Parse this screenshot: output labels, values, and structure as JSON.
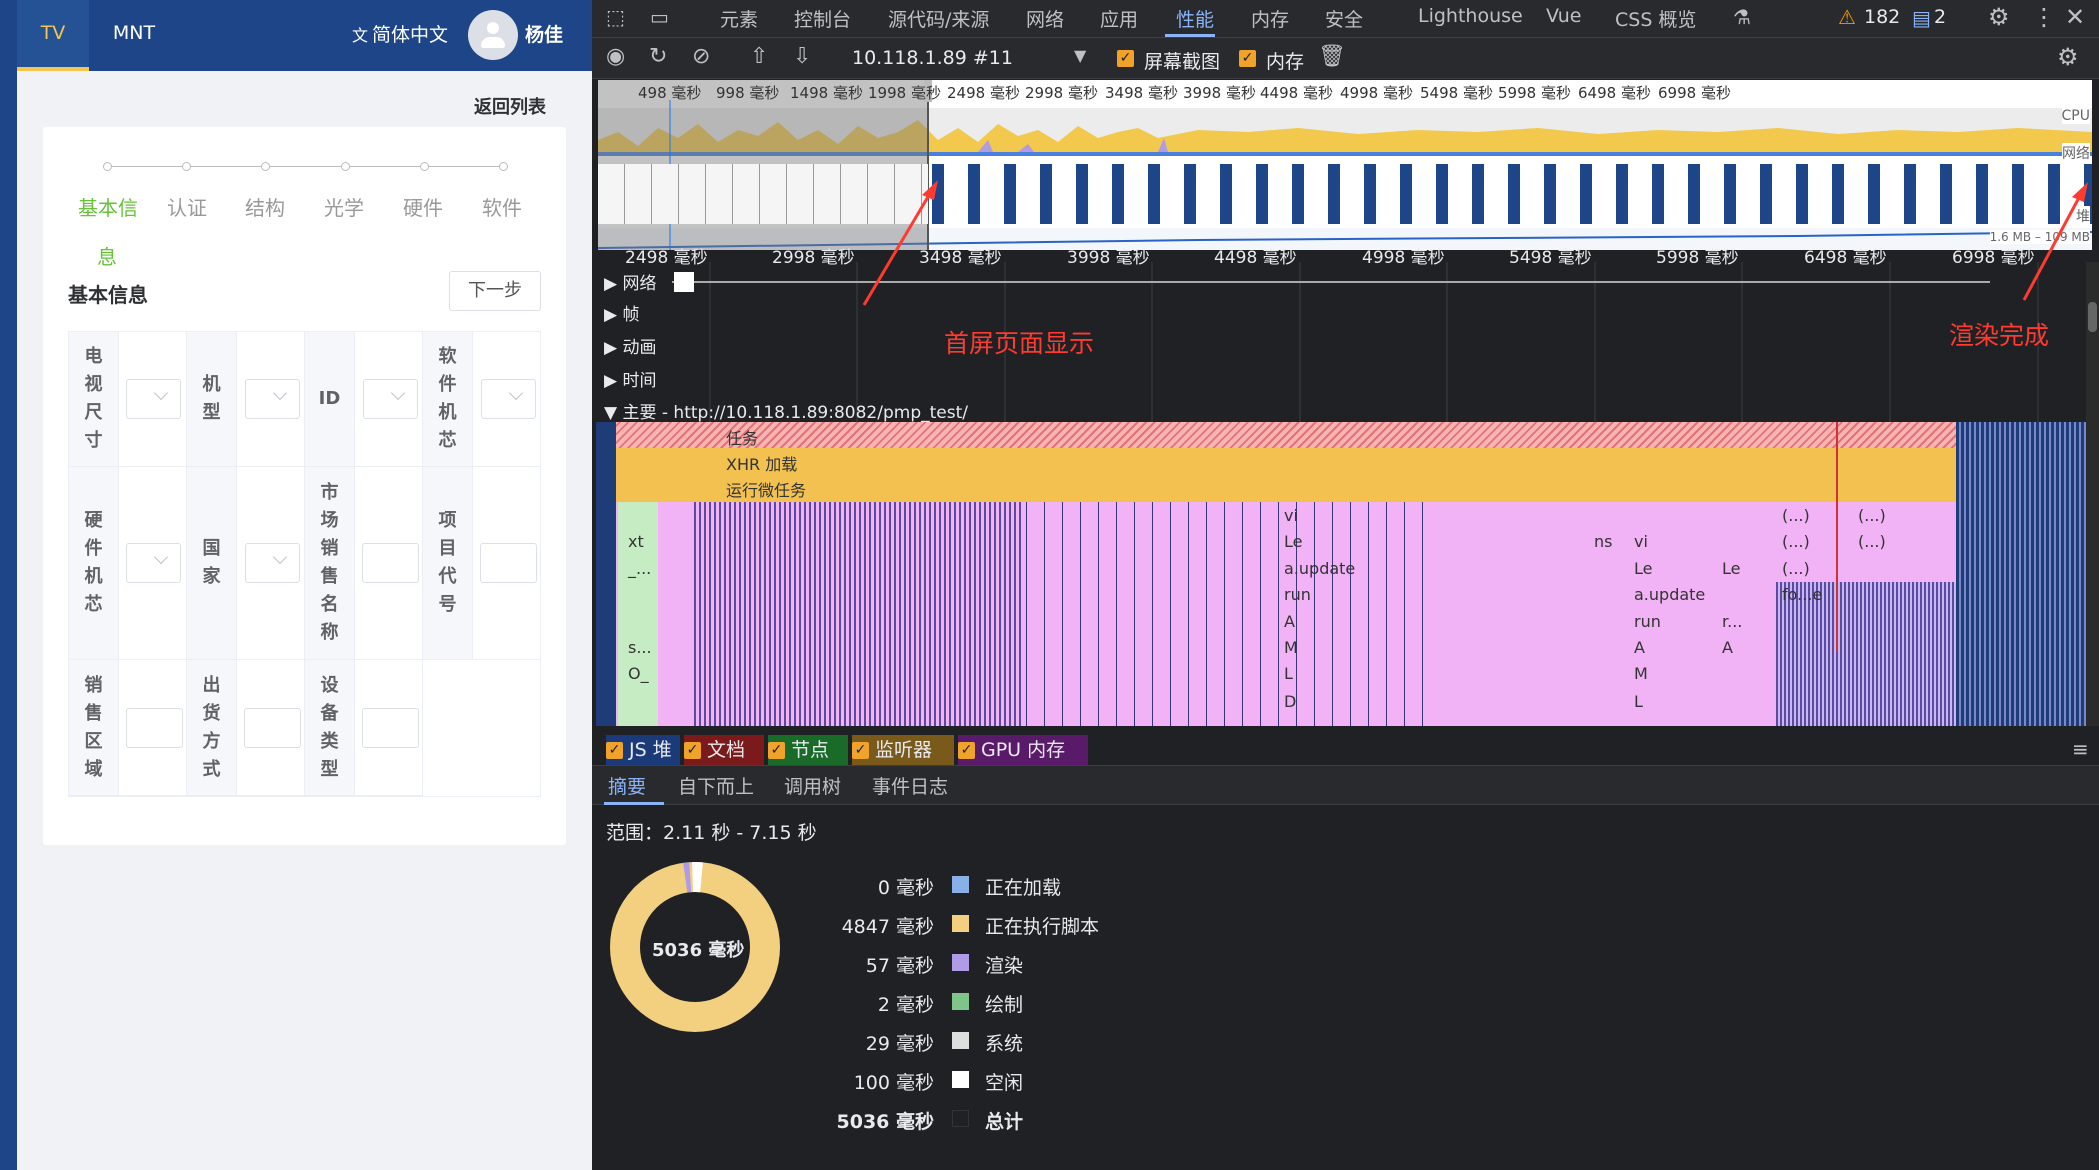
{
  "app": {
    "tabs": [
      "TV",
      "MNT"
    ],
    "language": "简体中文",
    "user": "杨佳",
    "back_link": "返回列表",
    "steps": [
      "基本信",
      "认证",
      "结构",
      "光学",
      "硬件",
      "软件"
    ],
    "step_wrap": "息",
    "section_title": "基本信息",
    "next_button": "下一步",
    "labels": {
      "tv_size": "电视尺寸",
      "model": "机型",
      "id": "ID",
      "sw_chip": "软件机芯",
      "hw_chip": "硬件机芯",
      "country": "国家",
      "market_name": "市场销售名称",
      "project_code": "项目代号",
      "sales_region": "销售区域",
      "ship_mode": "出货方式",
      "device_type": "设备类型"
    }
  },
  "devtools": {
    "tabs": [
      "元素",
      "控制台",
      "源代码/来源",
      "网络",
      "应用",
      "性能",
      "内存",
      "安全",
      "Lighthouse",
      "Vue",
      "CSS 概览"
    ],
    "warnings": "182",
    "messages": "2",
    "recording": "10.118.1.89 #11",
    "screenshots_label": "屏幕截图",
    "memory_label": "内存",
    "overview_ticks": [
      "498 毫秒",
      "998 毫秒",
      "1498 毫秒",
      "1998 毫秒",
      "2498 毫秒",
      "2998 毫秒",
      "3498 毫秒",
      "3998 毫秒",
      "4498 毫秒",
      "4998 毫秒",
      "5498 毫秒",
      "5998 毫秒",
      "6498 毫秒",
      "6998 毫秒"
    ],
    "overview_side": {
      "cpu": "CPU",
      "net": "网络",
      "heap": "堆",
      "heap_range": "1.6 MB – 109 MB"
    },
    "ruler_ticks": [
      "2498 毫秒",
      "2998 毫秒",
      "3498 毫秒",
      "3998 毫秒",
      "4498 毫秒",
      "4998 毫秒",
      "5498 毫秒",
      "5998 毫秒",
      "6498 毫秒",
      "6998 毫秒"
    ],
    "tracks": [
      "网络",
      "帧",
      "动画",
      "时间"
    ],
    "main_track": "主要 - http://10.118.1.89:8082/pmp_test/",
    "flame_labels": {
      "task": "任务",
      "xhr": "XHR 加载",
      "micro": "运行微任务",
      "vi": "vi",
      "le": "Le",
      "aupdate": "a.update",
      "run": "run",
      "a": "A",
      "m": "M",
      "l": "L",
      "d": "D",
      "xt": "xt",
      "dots": "_...",
      "s": "s...",
      "o": "O_",
      "ellipsis": "(...)",
      "ns": "ns",
      "foe": "fo...e",
      "r": "r..."
    },
    "annotations": [
      "首屏页面显示",
      "渲染完成"
    ],
    "categories": [
      "JS 堆",
      "文档",
      "节点",
      "监听器",
      "GPU 内存"
    ],
    "bottom_tabs": [
      "摘要",
      "自下而上",
      "调用树",
      "事件日志"
    ],
    "range": "范围：2.11 秒 - 7.15 秒",
    "donut_total": "5036 毫秒",
    "summary": [
      {
        "value": "0 毫秒",
        "label": "正在加载",
        "color": "#8ab0e8"
      },
      {
        "value": "4847 毫秒",
        "label": "正在执行脚本",
        "color": "#f2d07f"
      },
      {
        "value": "57 毫秒",
        "label": "渲染",
        "color": "#af9be6"
      },
      {
        "value": "2 毫秒",
        "label": "绘制",
        "color": "#7fc488"
      },
      {
        "value": "29 毫秒",
        "label": "系统",
        "color": "#dedede"
      },
      {
        "value": "100 毫秒",
        "label": "空闲",
        "color": "#ffffff"
      },
      {
        "value": "5036 毫秒",
        "label": "总计",
        "color": "#202124"
      }
    ]
  }
}
